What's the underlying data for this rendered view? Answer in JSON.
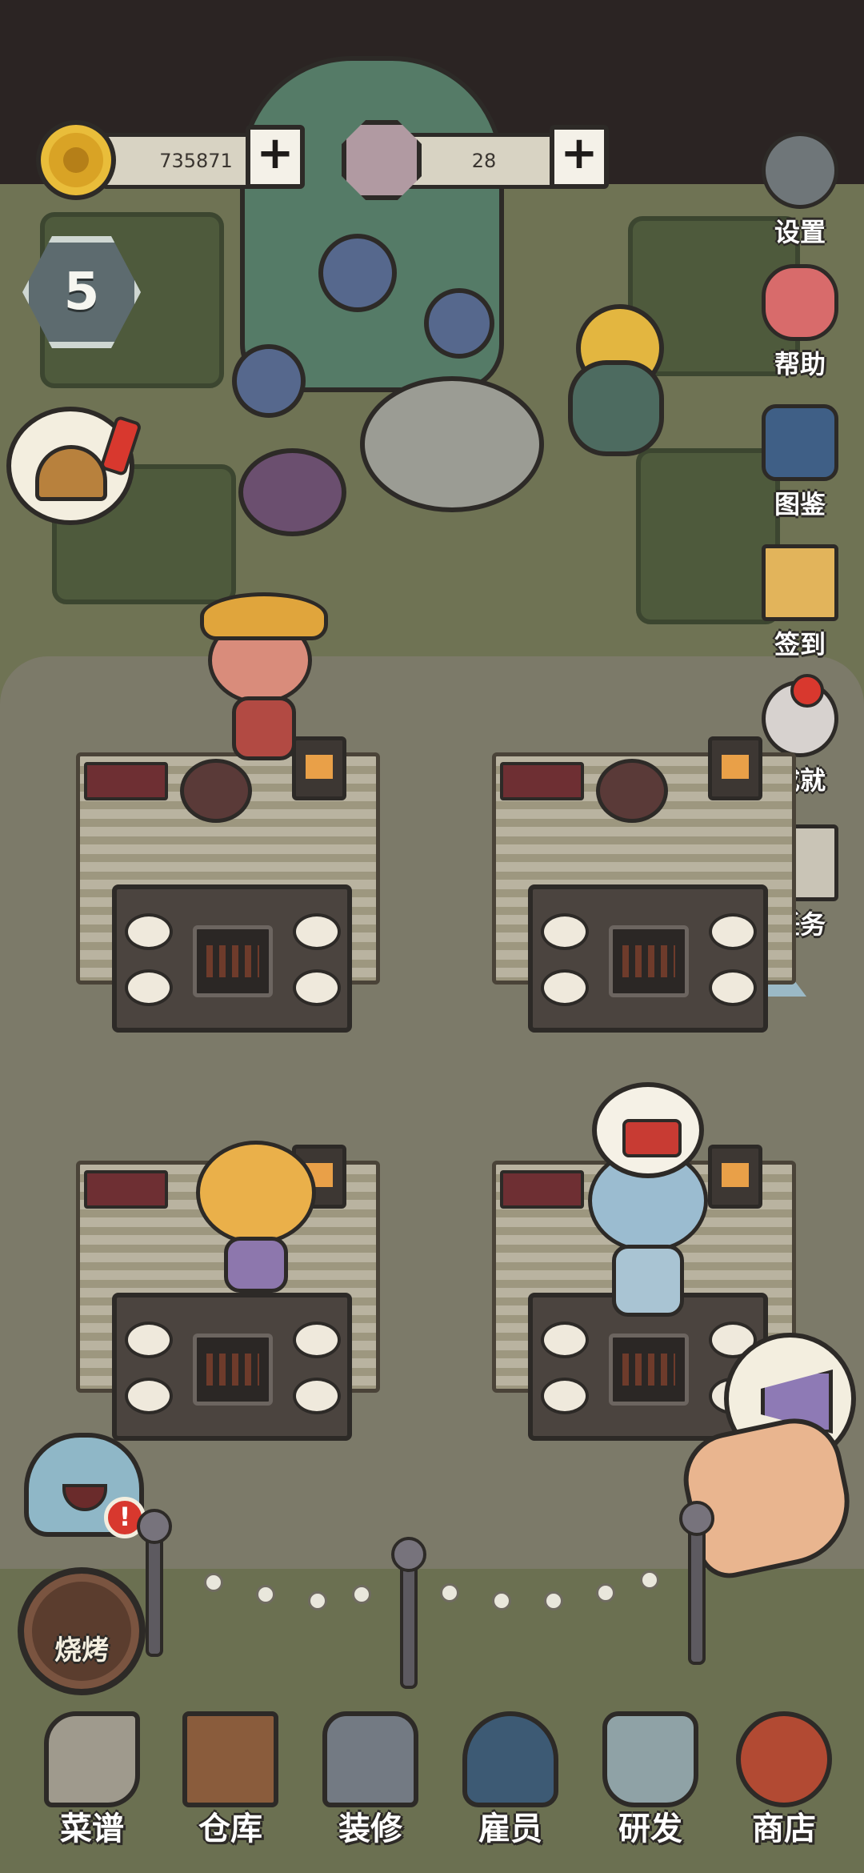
{
  "hud": {
    "coins": "735871",
    "gems": "28",
    "level": "5"
  },
  "side_menu": [
    {
      "label": "设置",
      "icon": "gear-icon",
      "color": "#6f7679"
    },
    {
      "label": "帮助",
      "icon": "question-icon",
      "color": "#d86b6b"
    },
    {
      "label": "图鉴",
      "icon": "book-icon",
      "color": "#3f5f86"
    },
    {
      "label": "签到",
      "icon": "letter-icon",
      "color": "#e2b45b"
    },
    {
      "label": "成就",
      "icon": "star-crystal-icon",
      "color": "#d7d2cf"
    },
    {
      "label": "任务",
      "icon": "map-scroll-icon",
      "color": "#c9c4b6"
    }
  ],
  "bbq_mode": {
    "label": "烧烤"
  },
  "bottom_nav": [
    {
      "label": "菜谱",
      "icon": "recipe-scroll-icon",
      "color": "#9f9a8d"
    },
    {
      "label": "仓库",
      "icon": "cabinet-icon",
      "color": "#8a5c3c"
    },
    {
      "label": "装修",
      "icon": "hammer-icon",
      "color": "#737a83"
    },
    {
      "label": "雇员",
      "icon": "employee-cap-icon",
      "color": "#3d5a74"
    },
    {
      "label": "研发",
      "icon": "cooking-pot-icon",
      "color": "#8fa2a6"
    },
    {
      "label": "商店",
      "icon": "treasure-bag-icon",
      "color": "#b24a33"
    }
  ],
  "colors": {
    "background_top": "#2b2423",
    "grass": "#6f7354",
    "path": "#7c7a69",
    "outline": "#2d2a27",
    "alert_red": "#d8382e"
  }
}
